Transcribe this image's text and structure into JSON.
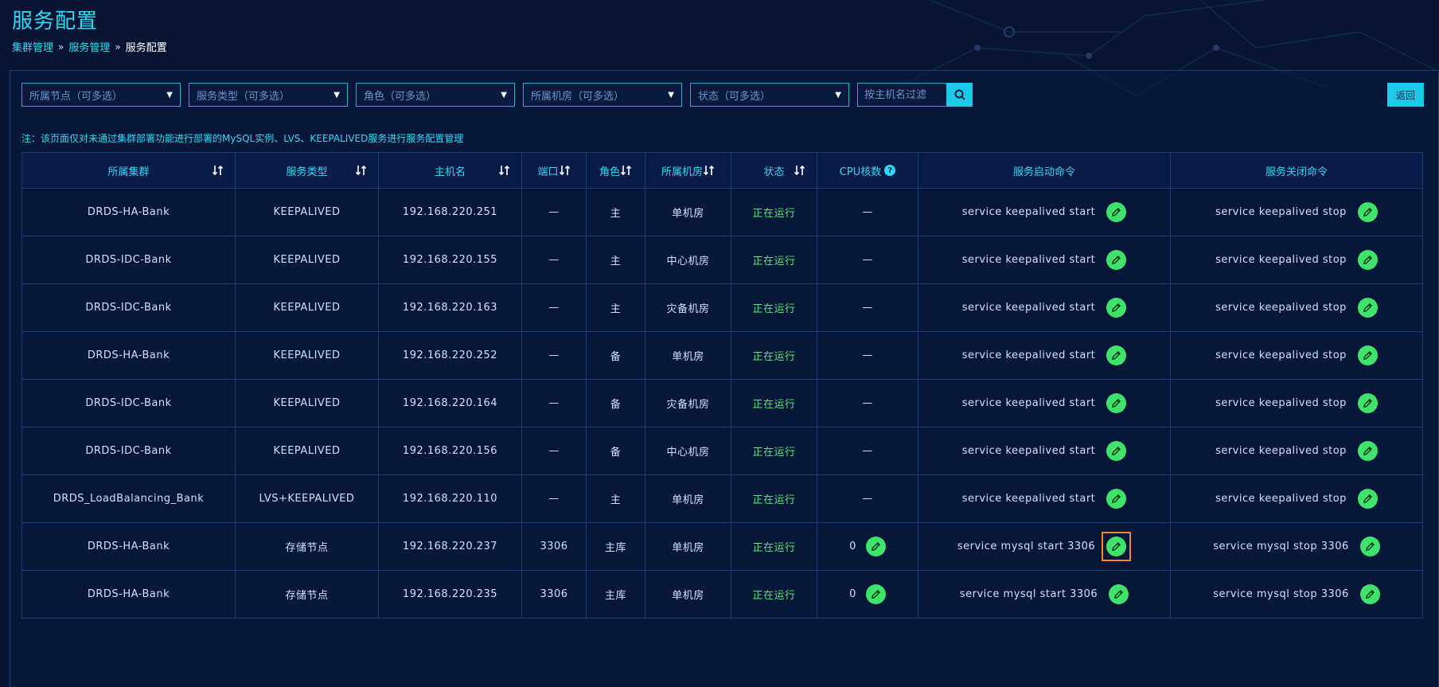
{
  "page": {
    "title": "服务配置",
    "breadcrumb": [
      "集群管理",
      "服务管理",
      "服务配置"
    ]
  },
  "filters": {
    "node": "所属节点（可多选）",
    "service_type": "服务类型（可多选）",
    "role": "角色（可多选）",
    "room": "所属机房（可多选）",
    "status": "状态（可多选）",
    "search_placeholder": "按主机名过滤"
  },
  "back_label": "返回",
  "note": "注：该页面仅对未通过集群部署功能进行部署的MySQL实例、LVS、KEEPALIVED服务进行服务配置管理",
  "columns": {
    "cluster": "所属集群",
    "service_type": "服务类型",
    "host": "主机名",
    "port": "端口",
    "role": "角色",
    "room": "所属机房",
    "status": "状态",
    "cpu": "CPU核数",
    "start_cmd": "服务启动命令",
    "stop_cmd": "服务关闭命令"
  },
  "rows": [
    {
      "cluster": "DRDS-HA-Bank",
      "service_type": "KEEPALIVED",
      "host": "192.168.220.251",
      "port": "—",
      "role": "主",
      "room": "单机房",
      "status": "正在运行",
      "cpu": "—",
      "start_cmd": "service keepalived start",
      "stop_cmd": "service keepalived stop"
    },
    {
      "cluster": "DRDS-IDC-Bank",
      "service_type": "KEEPALIVED",
      "host": "192.168.220.155",
      "port": "—",
      "role": "主",
      "room": "中心机房",
      "status": "正在运行",
      "cpu": "—",
      "start_cmd": "service keepalived start",
      "stop_cmd": "service keepalived stop"
    },
    {
      "cluster": "DRDS-IDC-Bank",
      "service_type": "KEEPALIVED",
      "host": "192.168.220.163",
      "port": "—",
      "role": "主",
      "room": "灾备机房",
      "status": "正在运行",
      "cpu": "—",
      "start_cmd": "service keepalived start",
      "stop_cmd": "service keepalived stop"
    },
    {
      "cluster": "DRDS-HA-Bank",
      "service_type": "KEEPALIVED",
      "host": "192.168.220.252",
      "port": "—",
      "role": "备",
      "room": "单机房",
      "status": "正在运行",
      "cpu": "—",
      "start_cmd": "service keepalived start",
      "stop_cmd": "service keepalived stop"
    },
    {
      "cluster": "DRDS-IDC-Bank",
      "service_type": "KEEPALIVED",
      "host": "192.168.220.164",
      "port": "—",
      "role": "备",
      "room": "灾备机房",
      "status": "正在运行",
      "cpu": "—",
      "start_cmd": "service keepalived start",
      "stop_cmd": "service keepalived stop"
    },
    {
      "cluster": "DRDS-IDC-Bank",
      "service_type": "KEEPALIVED",
      "host": "192.168.220.156",
      "port": "—",
      "role": "备",
      "room": "中心机房",
      "status": "正在运行",
      "cpu": "—",
      "start_cmd": "service keepalived start",
      "stop_cmd": "service keepalived stop"
    },
    {
      "cluster": "DRDS_LoadBalancing_Bank",
      "service_type": "LVS+KEEPALIVED",
      "host": "192.168.220.110",
      "port": "—",
      "role": "主",
      "room": "单机房",
      "status": "正在运行",
      "cpu": "—",
      "start_cmd": "service keepalived start",
      "stop_cmd": "service keepalived stop"
    },
    {
      "cluster": "DRDS-HA-Bank",
      "service_type": "存储节点",
      "host": "192.168.220.237",
      "port": "3306",
      "role": "主库",
      "room": "单机房",
      "status": "正在运行",
      "cpu": "0",
      "start_cmd": "service mysql start 3306",
      "stop_cmd": "service mysql stop 3306"
    },
    {
      "cluster": "DRDS-HA-Bank",
      "service_type": "存储节点",
      "host": "192.168.220.235",
      "port": "3306",
      "role": "主库",
      "room": "单机房",
      "status": "正在运行",
      "cpu": "0",
      "start_cmd": "service mysql start 3306",
      "stop_cmd": "service mysql stop 3306"
    }
  ],
  "colors": {
    "accent": "#2fd8f2",
    "running": "#4dea6e",
    "edit_button": "#3fe36b",
    "highlight": "#f08a2a"
  }
}
